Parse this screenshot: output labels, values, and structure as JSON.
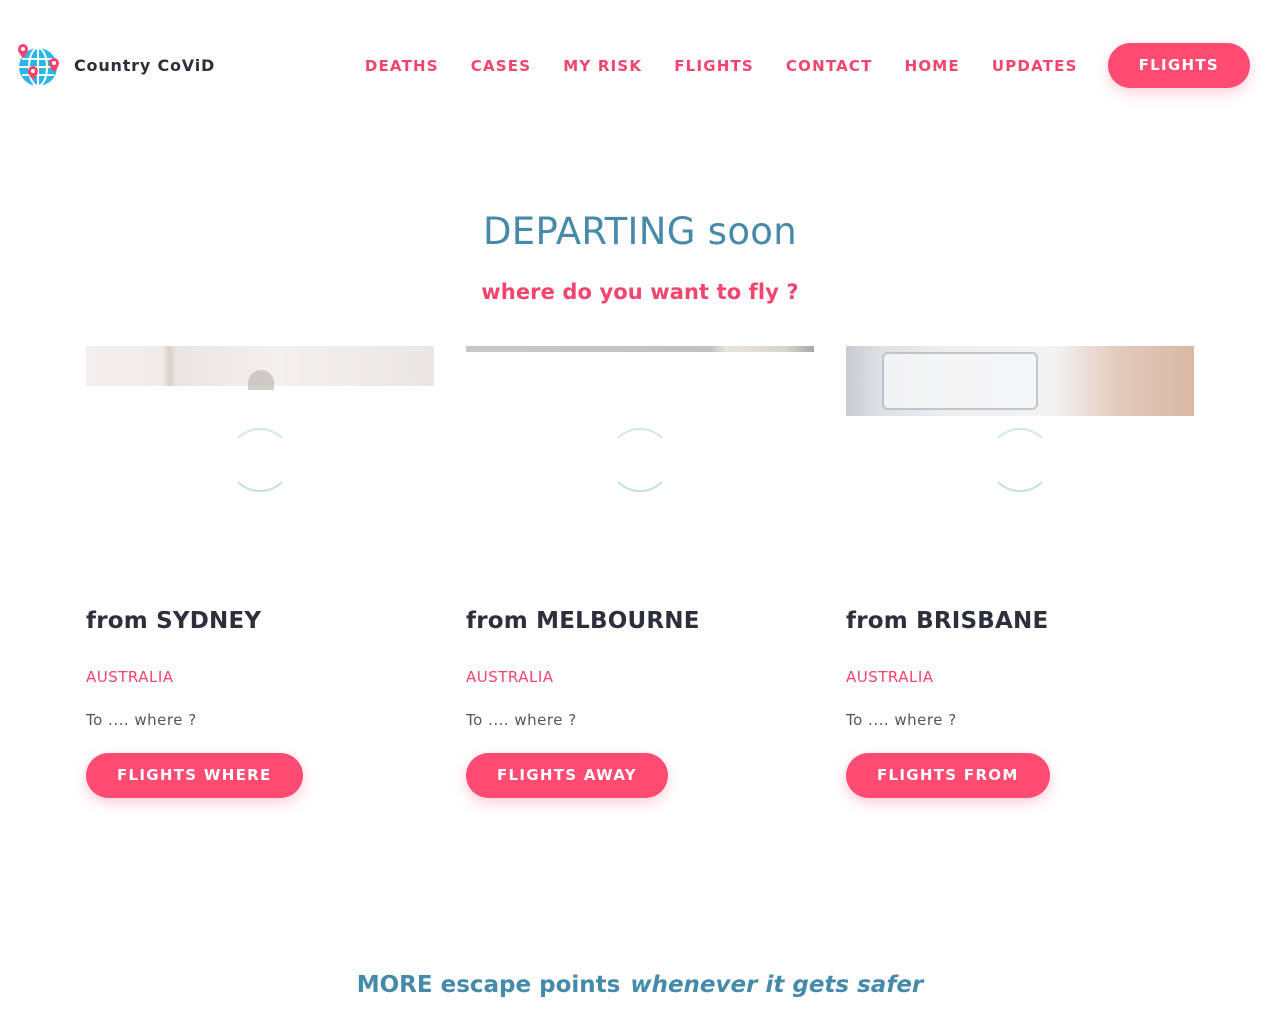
{
  "brand": {
    "name": "Country CoViD",
    "logo_icon": "globe-with-pins-icon"
  },
  "nav": {
    "links": [
      "DEATHS",
      "CASES",
      "MY RISK",
      "FLIGHTS",
      "CONTACT",
      "HOME",
      "UPDATES"
    ],
    "cta": "FLIGHTS"
  },
  "hero": {
    "title": "DEPARTING soon",
    "subtitle": "where do you want to fly ?"
  },
  "cards": [
    {
      "title": "from SYDNEY",
      "country": "AUSTRALIA",
      "text": "To .... where ?",
      "button": "FLIGHTS WHERE"
    },
    {
      "title": "from MELBOURNE",
      "country": "AUSTRALIA",
      "text": "To .... where ?",
      "button": "FLIGHTS AWAY"
    },
    {
      "title": "from BRISBANE",
      "country": "AUSTRALIA",
      "text": "To .... where ?",
      "button": "FLIGHTS FROM"
    }
  ],
  "more": {
    "lead": "MORE escape points",
    "emphasis": "whenever it gets safer"
  },
  "colors": {
    "accent": "#ff4a72",
    "accent_text": "#f2456e",
    "heading_blue": "#458aa8",
    "dark_text": "#2d2f3d"
  }
}
